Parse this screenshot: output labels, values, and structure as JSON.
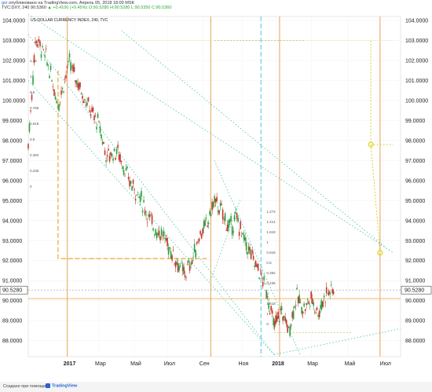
{
  "header": {
    "line1_user": "gsr",
    "line1_text": "опубликовано на TradingView.com, Апрель 05, 2018 18:00 MSK",
    "line2_symbol": "TVC:DXY, 240",
    "line2_values": "90.5360",
    "line2_change": "▲ +0.4100 (+0.45%)",
    "line2_ohlc": "O:90.5280 H:90.5280 L:90.5350 C:90.5360"
  },
  "footer": {
    "text": "Создано при помощи",
    "logo": "TradingView"
  },
  "chart_data": {
    "type": "candlestick",
    "title": "US DOLLAR CURRENCY INDEX, 240, TVC",
    "y_ticks": [
      "104.0000",
      "103.0000",
      "102.0000",
      "101.0000",
      "100.0000",
      "99.0000",
      "98.0000",
      "97.0000",
      "96.0000",
      "95.0000",
      "94.0000",
      "93.0000",
      "92.0000",
      "91.0000",
      "90.0000",
      "89.0000",
      "88.0000"
    ],
    "ylim": [
      87.2,
      104.2
    ],
    "x_ticks": [
      "2017",
      "Мар",
      "Май",
      "Июл",
      "Сен",
      "Ноя",
      "2018",
      "Мар",
      "Май",
      "Июл"
    ],
    "price_label_left": "90.5280",
    "price_label_right": "90.5280",
    "last_price": 90.528,
    "fib_labels_left": [
      "1.26",
      "1",
      "0.5",
      "0.786",
      "0.618",
      "0.5",
      "0.382",
      "0.236",
      "0"
    ],
    "fib_labels_mid": [
      "1.272",
      "1.414",
      "1.618",
      "1",
      "0.618",
      "0.5",
      "0.382",
      "0.236",
      "0",
      "1.618",
      "1",
      "0"
    ],
    "price_path": [
      [
        0.0,
        97.8
      ],
      [
        0.02,
        103.2
      ],
      [
        0.05,
        102.0
      ],
      [
        0.08,
        99.8
      ],
      [
        0.11,
        101.9
      ],
      [
        0.14,
        100.6
      ],
      [
        0.17,
        99.4
      ],
      [
        0.19,
        98.8
      ],
      [
        0.21,
        97.2
      ],
      [
        0.24,
        97.5
      ],
      [
        0.27,
        96.0
      ],
      [
        0.3,
        95.2
      ],
      [
        0.32,
        94.3
      ],
      [
        0.34,
        93.6
      ],
      [
        0.36,
        93.3
      ],
      [
        0.38,
        92.6
      ],
      [
        0.4,
        91.9
      ],
      [
        0.42,
        91.3
      ],
      [
        0.44,
        92.0
      ],
      [
        0.46,
        93.3
      ],
      [
        0.48,
        93.8
      ],
      [
        0.5,
        95.0
      ],
      [
        0.52,
        94.4
      ],
      [
        0.54,
        93.6
      ],
      [
        0.56,
        94.1
      ],
      [
        0.58,
        93.0
      ],
      [
        0.6,
        92.2
      ],
      [
        0.62,
        91.5
      ],
      [
        0.64,
        90.5
      ],
      [
        0.66,
        88.7
      ],
      [
        0.68,
        89.5
      ],
      [
        0.7,
        88.5
      ],
      [
        0.72,
        90.2
      ],
      [
        0.74,
        89.6
      ],
      [
        0.76,
        90.1
      ],
      [
        0.78,
        89.4
      ],
      [
        0.8,
        90.4
      ],
      [
        0.82,
        90.53
      ]
    ]
  }
}
